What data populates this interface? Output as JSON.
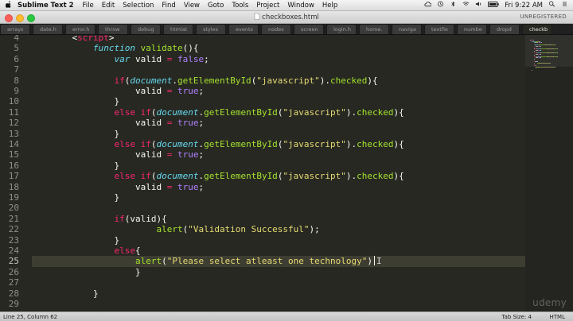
{
  "menubar": {
    "app_name": "Sublime Text 2",
    "items": [
      "File",
      "Edit",
      "Selection",
      "Find",
      "View",
      "Goto",
      "Tools",
      "Project",
      "Window",
      "Help"
    ],
    "clock": "Fri 9:22 AM"
  },
  "window": {
    "title": "checkboxes.html",
    "registration": "UNREGISTERED"
  },
  "tabs": [
    "arrays",
    "date.h",
    "error.h",
    "throw",
    "debug",
    "htmlat",
    "styles",
    "events",
    "nodes",
    "screen",
    "login.h",
    "home.",
    "naviga",
    "textfie",
    "numbe",
    "dropd",
    "checkb"
  ],
  "active_tab": 16,
  "editor": {
    "lines": [
      {
        "n": "4",
        "tokens": [
          [
            "    ",
            ""
          ],
          [
            "<",
            ""
          ],
          [
            "script",
            "op"
          ],
          [
            ">",
            ""
          ]
        ]
      },
      {
        "n": "5",
        "tokens": [
          [
            "        ",
            ""
          ],
          [
            "function",
            "kw"
          ],
          [
            " ",
            ""
          ],
          [
            "validate",
            "fn"
          ],
          [
            "(){",
            ""
          ]
        ]
      },
      {
        "n": "6",
        "tokens": [
          [
            "            ",
            ""
          ],
          [
            "var",
            "kw"
          ],
          [
            " valid ",
            ""
          ],
          [
            "=",
            "op"
          ],
          [
            " ",
            ""
          ],
          [
            "false",
            "bool"
          ],
          [
            ";",
            ""
          ]
        ]
      },
      {
        "n": "7",
        "tokens": []
      },
      {
        "n": "8",
        "tokens": [
          [
            "            ",
            ""
          ],
          [
            "if",
            "op"
          ],
          [
            "(",
            ""
          ],
          [
            "document",
            "kw"
          ],
          [
            ".",
            ""
          ],
          [
            "getElementById",
            "fn"
          ],
          [
            "(",
            ""
          ],
          [
            "\"javascript\"",
            "str"
          ],
          [
            ").",
            ""
          ],
          [
            "checked",
            "fn"
          ],
          [
            "){",
            ""
          ]
        ]
      },
      {
        "n": "9",
        "tokens": [
          [
            "                ",
            ""
          ],
          [
            "valid ",
            ""
          ],
          [
            "=",
            "op"
          ],
          [
            " ",
            ""
          ],
          [
            "true",
            "bool"
          ],
          [
            ";",
            ""
          ]
        ]
      },
      {
        "n": "10",
        "tokens": [
          [
            "            ",
            ""
          ],
          [
            "}",
            ""
          ]
        ]
      },
      {
        "n": "11",
        "tokens": [
          [
            "            ",
            ""
          ],
          [
            "else",
            "op"
          ],
          [
            " ",
            ""
          ],
          [
            "if",
            "op"
          ],
          [
            "(",
            ""
          ],
          [
            "document",
            "kw"
          ],
          [
            ".",
            ""
          ],
          [
            "getElementById",
            "fn"
          ],
          [
            "(",
            ""
          ],
          [
            "\"javascript\"",
            "str"
          ],
          [
            ").",
            ""
          ],
          [
            "checked",
            "fn"
          ],
          [
            "){",
            ""
          ]
        ]
      },
      {
        "n": "12",
        "tokens": [
          [
            "                ",
            ""
          ],
          [
            "valid ",
            ""
          ],
          [
            "=",
            "op"
          ],
          [
            " ",
            ""
          ],
          [
            "true",
            "bool"
          ],
          [
            ";",
            ""
          ]
        ]
      },
      {
        "n": "13",
        "tokens": [
          [
            "            ",
            ""
          ],
          [
            "}",
            ""
          ]
        ]
      },
      {
        "n": "14",
        "tokens": [
          [
            "            ",
            ""
          ],
          [
            "else",
            "op"
          ],
          [
            " ",
            ""
          ],
          [
            "if",
            "op"
          ],
          [
            "(",
            ""
          ],
          [
            "document",
            "kw"
          ],
          [
            ".",
            ""
          ],
          [
            "getElementById",
            "fn"
          ],
          [
            "(",
            ""
          ],
          [
            "\"javascript\"",
            "str"
          ],
          [
            ").",
            ""
          ],
          [
            "checked",
            "fn"
          ],
          [
            "){",
            ""
          ]
        ]
      },
      {
        "n": "15",
        "tokens": [
          [
            "                ",
            ""
          ],
          [
            "valid ",
            ""
          ],
          [
            "=",
            "op"
          ],
          [
            " ",
            ""
          ],
          [
            "true",
            "bool"
          ],
          [
            ";",
            ""
          ]
        ]
      },
      {
        "n": "16",
        "tokens": [
          [
            "            ",
            ""
          ],
          [
            "}",
            ""
          ]
        ]
      },
      {
        "n": "17",
        "tokens": [
          [
            "            ",
            ""
          ],
          [
            "else",
            "op"
          ],
          [
            " ",
            ""
          ],
          [
            "if",
            "op"
          ],
          [
            "(",
            ""
          ],
          [
            "document",
            "kw"
          ],
          [
            ".",
            ""
          ],
          [
            "getElementById",
            "fn"
          ],
          [
            "(",
            ""
          ],
          [
            "\"javascript\"",
            "str"
          ],
          [
            ").",
            ""
          ],
          [
            "checked",
            "fn"
          ],
          [
            "){",
            ""
          ]
        ]
      },
      {
        "n": "18",
        "tokens": [
          [
            "                ",
            ""
          ],
          [
            "valid ",
            ""
          ],
          [
            "=",
            "op"
          ],
          [
            " ",
            ""
          ],
          [
            "true",
            "bool"
          ],
          [
            ";",
            ""
          ]
        ]
      },
      {
        "n": "19",
        "tokens": [
          [
            "            ",
            ""
          ],
          [
            "}",
            ""
          ]
        ]
      },
      {
        "n": "20",
        "tokens": []
      },
      {
        "n": "21",
        "tokens": [
          [
            "            ",
            ""
          ],
          [
            "if",
            "op"
          ],
          [
            "(valid){",
            ""
          ]
        ]
      },
      {
        "n": "22",
        "tokens": [
          [
            "                    ",
            ""
          ],
          [
            "alert",
            "fn"
          ],
          [
            "(",
            ""
          ],
          [
            "\"Validation Successful\"",
            "str"
          ],
          [
            ");",
            ""
          ]
        ]
      },
      {
        "n": "23",
        "tokens": [
          [
            "            ",
            ""
          ],
          [
            "}",
            ""
          ]
        ]
      },
      {
        "n": "24",
        "tokens": [
          [
            "            ",
            ""
          ],
          [
            "else",
            "op"
          ],
          [
            "{",
            ""
          ]
        ]
      },
      {
        "n": "25",
        "tokens": [
          [
            "                ",
            ""
          ],
          [
            "alert",
            "fn"
          ],
          [
            "(",
            ""
          ],
          [
            "\"Please select atleast one technology\"",
            "str"
          ],
          [
            ")",
            ""
          ]
        ]
      },
      {
        "n": "26",
        "tokens": [
          [
            "                ",
            ""
          ],
          [
            "}",
            ""
          ]
        ]
      },
      {
        "n": "27",
        "tokens": []
      },
      {
        "n": "28",
        "tokens": [
          [
            "        ",
            ""
          ],
          [
            "}",
            ""
          ]
        ]
      },
      {
        "n": "29",
        "tokens": []
      }
    ],
    "current_line": "25"
  },
  "statusbar": {
    "position": "Line 25, Column 62",
    "tab_size": "Tab Size: 4",
    "syntax": "HTML"
  },
  "watermark": "udemy",
  "colors": {
    "background": "#272822",
    "keyword": "#66d9ef",
    "function": "#a6e22e",
    "operator": "#f92672",
    "string": "#e6db74",
    "boolean": "#ae81ff"
  }
}
